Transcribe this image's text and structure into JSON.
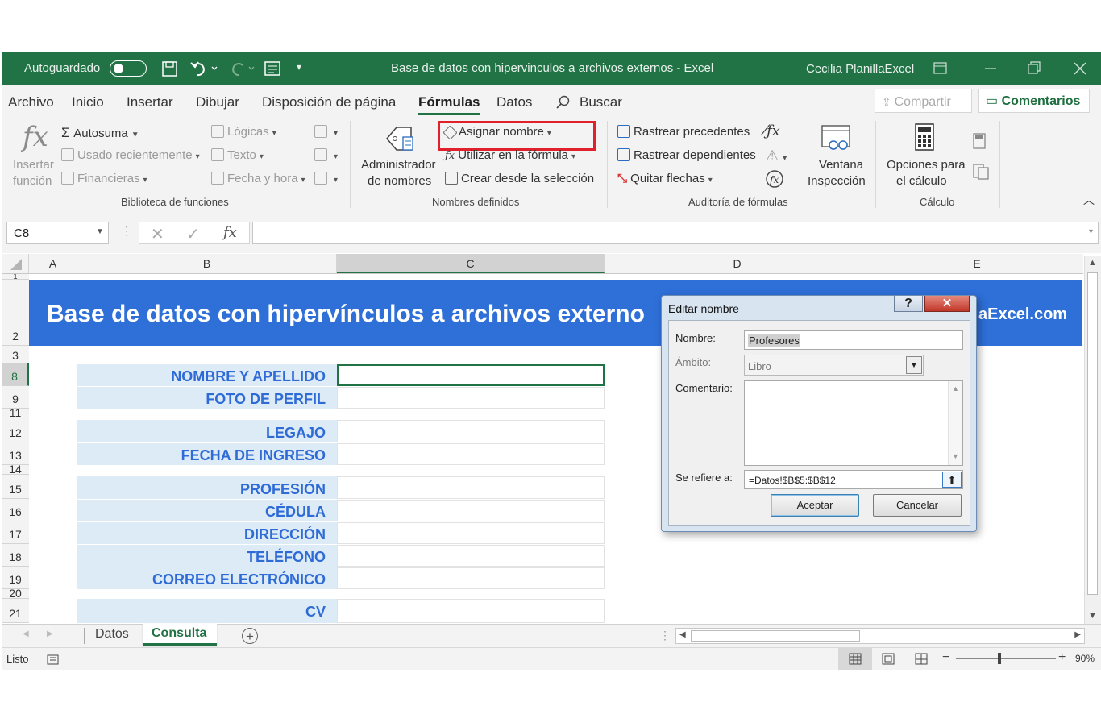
{
  "titlebar": {
    "autosave_label": "Autoguardado",
    "doc_title": "Base de datos con hipervinculos a archivos externos  -  Excel",
    "user": "Cecilia PlanillaExcel"
  },
  "menu": {
    "items": [
      "Archivo",
      "Inicio",
      "Insertar",
      "Dibujar",
      "Disposición de página",
      "Fórmulas",
      "Datos",
      "Buscar"
    ],
    "share": "Compartir",
    "comments": "Comentarios"
  },
  "ribbon": {
    "insert_function": [
      "Insertar",
      "función"
    ],
    "autosuma": "Autosuma",
    "usado": "Usado recientemente",
    "financieras": "Financieras",
    "logicas": "Lógicas",
    "texto": "Texto",
    "fecha": "Fecha y hora",
    "group_biblioteca": "Biblioteca de funciones",
    "admin": [
      "Administrador",
      "de nombres"
    ],
    "asignar": "Asignar nombre",
    "utilizar": "Utilizar en la fórmula",
    "crear": "Crear desde la selección",
    "group_nombres": "Nombres definidos",
    "rastrear_prec": "Rastrear precedentes",
    "rastrear_dep": "Rastrear dependientes",
    "quitar": "Quitar flechas",
    "ventana": [
      "Ventana",
      "Inspección"
    ],
    "group_auditoria": "Auditoría de fórmulas",
    "opciones": [
      "Opciones para",
      "el cálculo"
    ],
    "group_calculo": "Cálculo",
    "highlight_color": "#e0202a"
  },
  "formula_bar": {
    "namebox": "C8",
    "fx": "fx",
    "content": ""
  },
  "columns": [
    "A",
    "B",
    "C",
    "D",
    "E"
  ],
  "sheet": {
    "banner_title": "Base de datos con hipervínculos a archivos externo",
    "banner_right": "aExcel.com",
    "banner_color": "#2e6fd8",
    "rows": [
      {
        "num": "1",
        "label": ""
      },
      {
        "num": "2",
        "label": ""
      },
      {
        "num": "3",
        "label": ""
      },
      {
        "num": "8",
        "label": "NOMBRE Y APELLIDO"
      },
      {
        "num": "9",
        "label": "FOTO DE PERFIL"
      },
      {
        "num": "11",
        "label": ""
      },
      {
        "num": "12",
        "label": "LEGAJO"
      },
      {
        "num": "13",
        "label": "FECHA DE INGRESO"
      },
      {
        "num": "14",
        "label": ""
      },
      {
        "num": "15",
        "label": "PROFESIÓN"
      },
      {
        "num": "16",
        "label": "CÉDULA"
      },
      {
        "num": "17",
        "label": "DIRECCIÓN"
      },
      {
        "num": "18",
        "label": "TELÉFONO"
      },
      {
        "num": "19",
        "label": "CORREO ELECTRÓNICO"
      },
      {
        "num": "20",
        "label": ""
      },
      {
        "num": "21",
        "label": "CV"
      }
    ]
  },
  "dialog": {
    "title": "Editar nombre",
    "help": "?",
    "close": "✕",
    "nombre_label": "Nombre:",
    "nombre_value": "Profesores",
    "ambito_label": "Ámbito:",
    "ambito_value": "Libro",
    "comentario_label": "Comentario:",
    "refiere_label": "Se refiere a:",
    "refiere_value": "=Datos!$B$5:$B$12",
    "ok": "Aceptar",
    "cancel": "Cancelar"
  },
  "tabs": {
    "items": [
      "Datos",
      "Consulta"
    ],
    "active": "Consulta",
    "add": "+"
  },
  "status": {
    "ready": "Listo",
    "zoom": "90%",
    "minus": "−",
    "plus": "+"
  }
}
